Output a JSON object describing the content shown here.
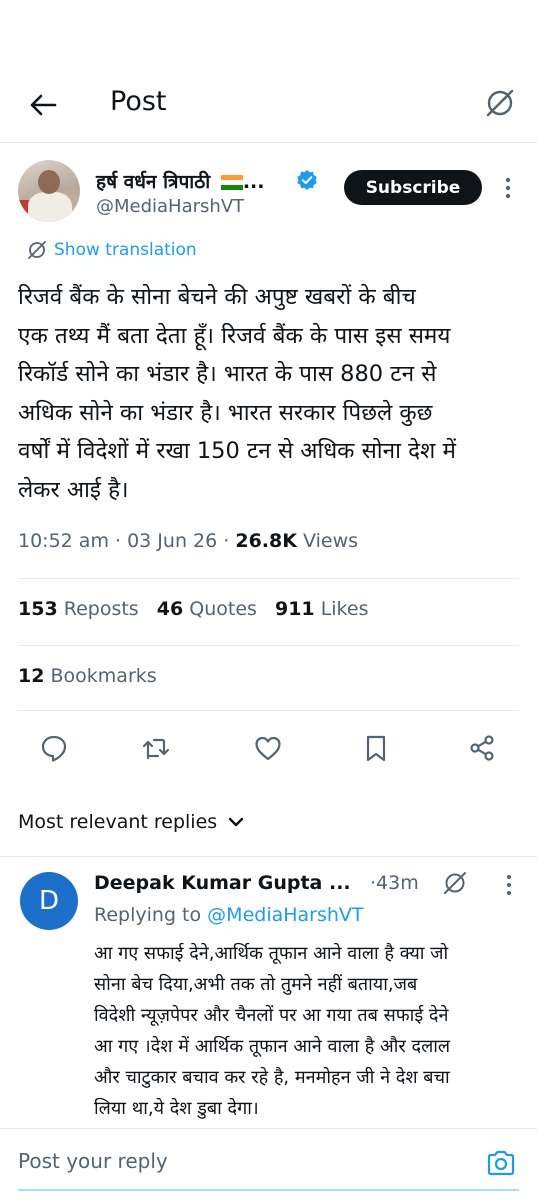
{
  "header": {
    "title": "Post"
  },
  "author": {
    "name": "हर्ष वर्धन त्रिपाठी",
    "name_suffix": "...",
    "handle": "@MediaHarshVT",
    "subscribe_label": "Subscribe"
  },
  "translation": {
    "label": "Show translation"
  },
  "tweet": {
    "lines": [
      "रिजर्व बैंक के सोना बेचने की अपुष्ट खबरों के बीच",
      "एक तथ्य मैं बता देता हूँ। रिजर्व बैंक के पास इस समय",
      "रिकॉर्ड सोने का भंडार है। भारत के पास 880 टन से",
      "अधिक सोने का भंडार है। भारत सरकार पिछले कुछ",
      "वर्षों में विदेशों में रखा 150 टन से अधिक सोना देश में",
      "लेकर आई है।"
    ]
  },
  "meta": {
    "time": "10:52 am",
    "date": "03 Jun 26",
    "views_count": "26.8K",
    "views_label": "Views",
    "sep": "·"
  },
  "stats": {
    "reposts_count": "153",
    "reposts_label": "Reposts",
    "quotes_count": "46",
    "quotes_label": "Quotes",
    "likes_count": "911",
    "likes_label": "Likes",
    "bookmarks_count": "12",
    "bookmarks_label": "Bookmarks"
  },
  "actions": [
    "reply-icon",
    "repost-icon",
    "like-icon",
    "bookmark-icon",
    "share-icon"
  ],
  "replies_sort": {
    "label": "Most relevant replies"
  },
  "reply": {
    "avatar_letter": "D",
    "name": "Deepak Kumar Gupta ...",
    "time": "·43m",
    "replying_prefix": "Replying to",
    "replying_handle": "@MediaHarshVT",
    "lines": [
      "आ गए सफाई देने,आर्थिक तूफान आने वाला है क्या जो",
      "सोना बेच दिया,अभी तक तो तुमने नहीं बताया,जब",
      "विदेशी न्यूज़पेपर और चैनलों पर आ गया तब सफाई देने",
      "आ गए ।देश में आर्थिक तूफान आने वाला है और दलाल",
      "और चाटुकार बचाव कर रहे है, मनमोहन जी ने देश बचा",
      "लिया था,ये देश डुबा देगा।"
    ]
  },
  "composer": {
    "placeholder": "Post your reply"
  },
  "colors": {
    "accent": "#1d9bf0",
    "text": "#0f1419",
    "muted": "#536471",
    "avatar_reply": "#1e6fc9"
  }
}
